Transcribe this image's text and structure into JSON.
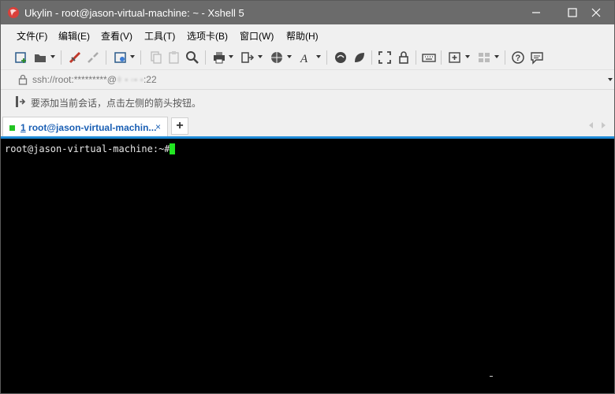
{
  "window": {
    "title": "Ukylin - root@jason-virtual-machine: ~ - Xshell 5",
    "controls": {
      "minimize": "—",
      "maximize": "☐",
      "close": "✕"
    }
  },
  "menu": [
    "文件(F)",
    "编辑(E)",
    "查看(V)",
    "工具(T)",
    "选项卡(B)",
    "窗口(W)",
    "帮助(H)"
  ],
  "toolbar_icons": [
    "new-session",
    "open-folder",
    "connect",
    "disconnect",
    "properties",
    "copy",
    "paste",
    "find",
    "print",
    "transfer",
    "globe",
    "font",
    "xftp",
    "xagent",
    "fullscreen",
    "lock",
    "keyboard",
    "add-tab",
    "layout",
    "help",
    "chat"
  ],
  "address": {
    "text": "ssh://root:*********@",
    "port_suffix": ":22",
    "masked": "ǂ ▪ ▫▪ ▪"
  },
  "info": {
    "text": "要添加当前会话，点击左侧的箭头按钮。"
  },
  "tabs": [
    {
      "number": "1",
      "label": "root@jason-virtual-machin...",
      "close": "×",
      "status_color": "#22c322"
    }
  ],
  "new_tab": "+",
  "terminal": {
    "prompt": "root@jason-virtual-machine:~#",
    "cursor_color": "#22e622"
  },
  "colors": {
    "titlebar": "#6b6b6b",
    "tab_accent": "#1e8ad6",
    "tab_text": "#1a5fb4",
    "terminal_bg": "#000000"
  }
}
